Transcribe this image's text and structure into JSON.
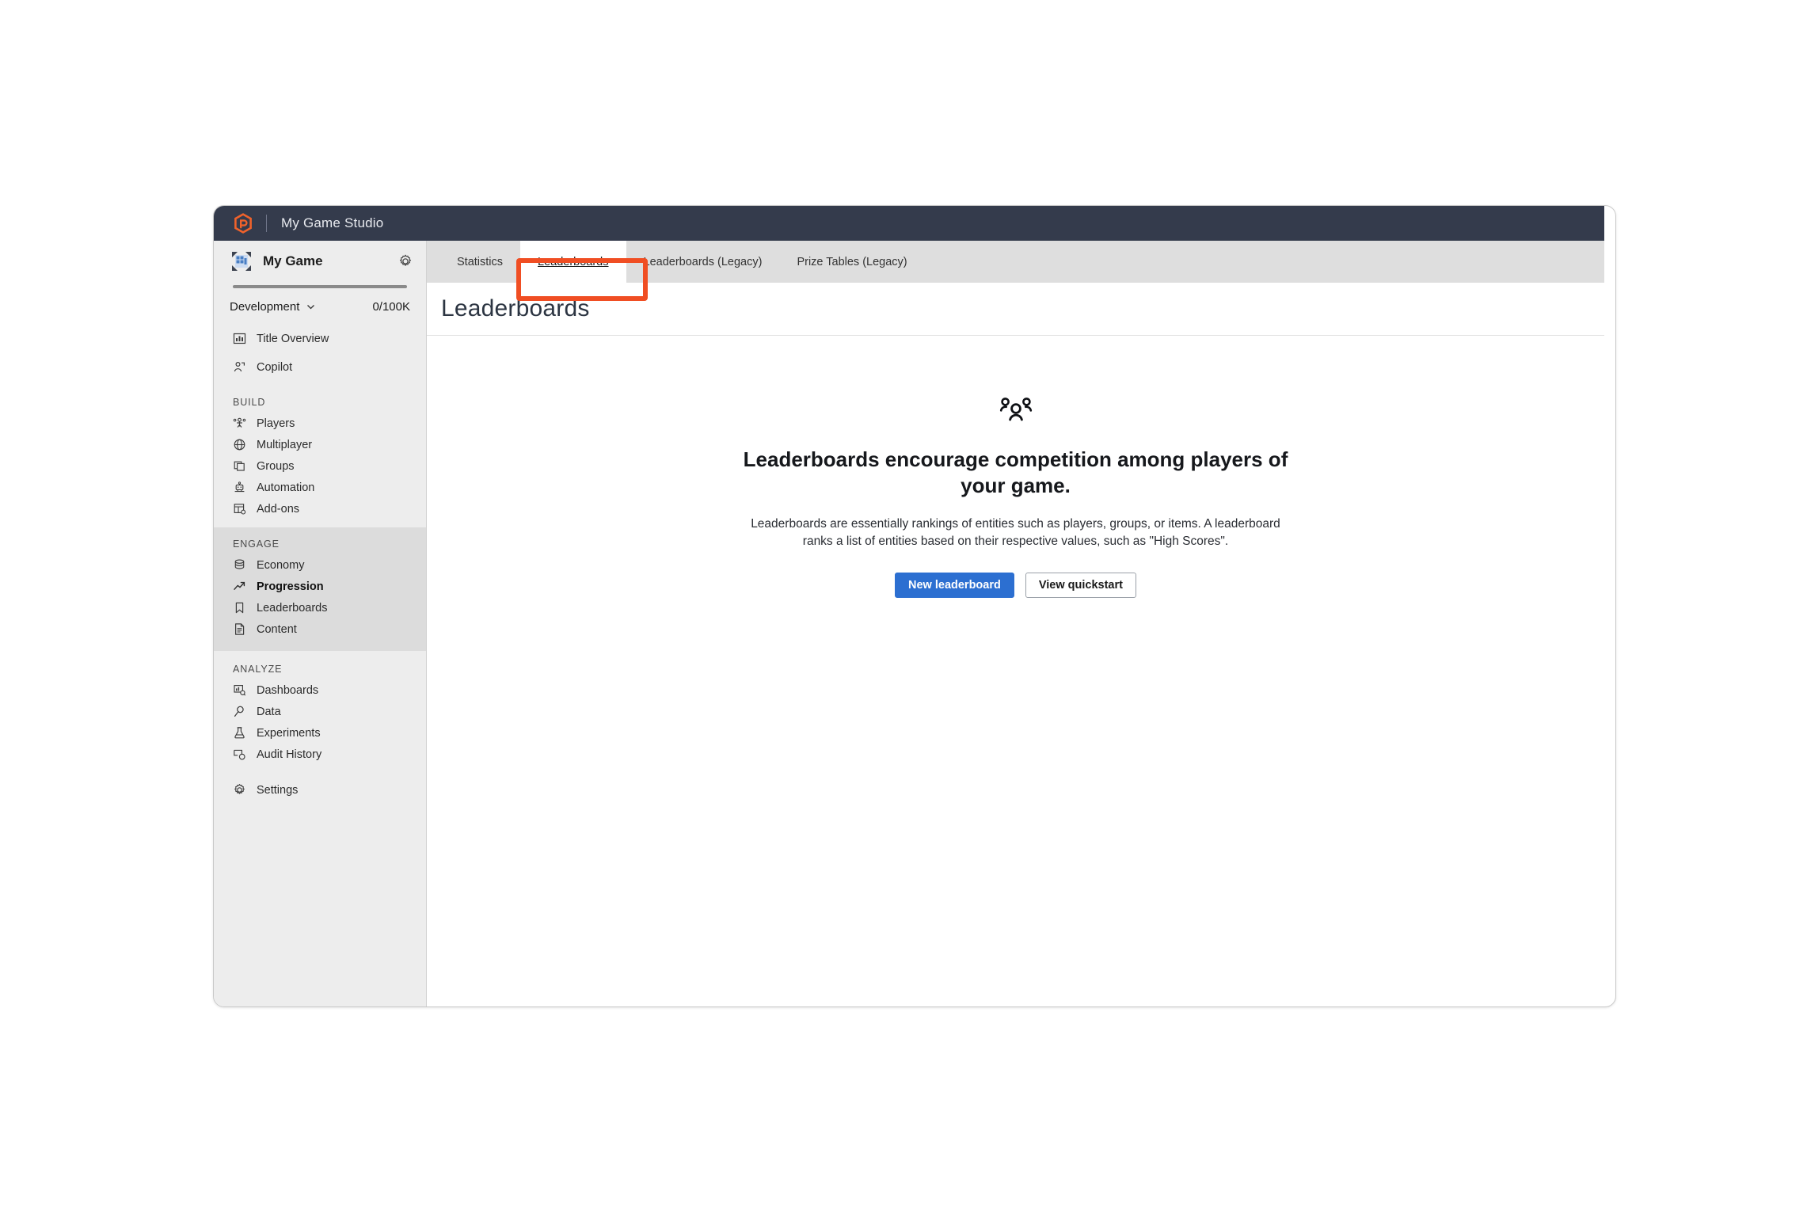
{
  "header": {
    "logo_icon": "playfab-hexagon-logo-icon",
    "title": "My Game Studio",
    "bg_color": "#343b4c",
    "logo_color": "#f0622b"
  },
  "sidebar": {
    "game": {
      "icon": "game-tile-icon",
      "name": "My Game",
      "settings_icon": "gear-icon"
    },
    "environment": {
      "name": "Development",
      "chevron_icon": "chevron-down-icon",
      "quota": "0/100K"
    },
    "top_items": [
      {
        "label": "Title Overview",
        "icon": "bar-chart-icon"
      },
      {
        "label": "Copilot",
        "icon": "copilot-person-icon"
      }
    ],
    "groups": [
      {
        "label": "BUILD",
        "items": [
          {
            "label": "Players",
            "icon": "players-icon"
          },
          {
            "label": "Multiplayer",
            "icon": "globe-icon"
          },
          {
            "label": "Groups",
            "icon": "stacked-squares-icon"
          },
          {
            "label": "Automation",
            "icon": "robot-icon"
          },
          {
            "label": "Add-ons",
            "icon": "addons-grid-icon"
          }
        ]
      },
      {
        "label": "ENGAGE",
        "highlighted": true,
        "items": [
          {
            "label": "Economy",
            "icon": "coins-stack-icon"
          },
          {
            "label": "Progression",
            "icon": "trending-up-arrow-icon",
            "active": true
          },
          {
            "label": "Leaderboards",
            "icon": "bookmark-icon"
          },
          {
            "label": "Content",
            "icon": "document-icon"
          }
        ]
      },
      {
        "label": "ANALYZE",
        "items": [
          {
            "label": "Dashboards",
            "icon": "dashboard-search-icon"
          },
          {
            "label": "Data",
            "icon": "magnifier-icon"
          },
          {
            "label": "Experiments",
            "icon": "flask-icon"
          },
          {
            "label": "Audit History",
            "icon": "audit-shield-icon"
          }
        ]
      }
    ],
    "settings_item": {
      "label": "Settings",
      "icon": "gear-icon"
    }
  },
  "tabs": [
    {
      "label": "Statistics",
      "selected": false
    },
    {
      "label": "Leaderboards",
      "selected": true
    },
    {
      "label": "Leaderboards (Legacy)",
      "selected": false
    },
    {
      "label": "Prize Tables (Legacy)",
      "selected": false
    }
  ],
  "page": {
    "title": "Leaderboards"
  },
  "empty_state": {
    "icon": "people-group-icon",
    "heading": "Leaderboards encourage competition among players of your game.",
    "description": "Leaderboards are essentially rankings of entities such as players, groups, or items. A leaderboard ranks a list of entities based on their respective values, such as \"High Scores\".",
    "primary_button": "New leaderboard",
    "secondary_button": "View quickstart",
    "primary_color": "#2c6fd1"
  },
  "annotation": {
    "target": "Leaderboards",
    "color": "#f04e23"
  }
}
